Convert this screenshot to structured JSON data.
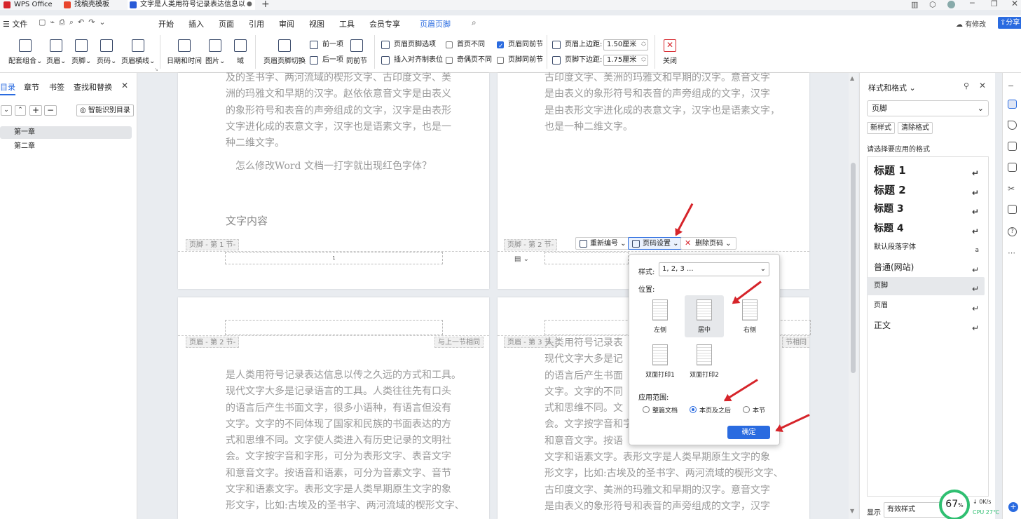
{
  "titlebar": {
    "tabs": [
      {
        "label": "WPS Office",
        "color": "#d6242a"
      },
      {
        "label": "找稿壳模板",
        "color": "#e8452c"
      },
      {
        "label": "文字是人类用符号记录表达信息以",
        "color": "#2a5bd7"
      }
    ],
    "new_tab": "+"
  },
  "menubar": {
    "file": "文件",
    "items": [
      "开始",
      "插入",
      "页面",
      "引用",
      "审阅",
      "视图",
      "工具",
      "会员专享",
      "页眉页脚"
    ],
    "active": "页眉页脚",
    "changes": "有修改",
    "share": "分享"
  },
  "ribbon": {
    "big_buttons": [
      "配套组合",
      "页眉",
      "页脚",
      "页码",
      "页眉横线",
      "日期和时间",
      "图片",
      "域",
      "页眉页脚切换",
      "同前节"
    ],
    "small": {
      "prev": "前一项",
      "next": "后一项",
      "options": "页眉页脚选项",
      "tab_align": "插入对齐制表位",
      "first_page": "首页不同",
      "odd_even": "奇偶页不同",
      "header_same": "页眉同前节",
      "footer_same": "页脚同前节",
      "top_margin_label": "页眉上边距:",
      "top_margin_value": "1.50厘米",
      "bottom_margin_label": "页脚下边距:",
      "bottom_margin_value": "1.75厘米",
      "close": "关闭"
    },
    "checks": {
      "first_page": false,
      "odd_even": false,
      "header_same": true,
      "footer_same": false
    }
  },
  "leftnav": {
    "tabs": [
      "目录",
      "章节",
      "书签",
      "查找和替换"
    ],
    "smart_toc": "智能识别目录",
    "items": [
      "第一章",
      "第二章"
    ]
  },
  "doc": {
    "p1_lines": [
      "及的圣书字、两河流域的楔形文字、古印度文字、美",
      "洲的玛雅文和早期的汉字。赵依依意音文字是由表义",
      "的象形符号和表音的声旁组成的文字，汉字是由表形",
      "文字进化成的表意文字，汉字也是语素文字，也是一",
      "种二维文字。"
    ],
    "p1_question": "怎么修改Word 文档一打字就出现红色字体？",
    "p1_heading": "文字内容",
    "p1_footer_tag": "页脚 - 第 1 节-",
    "p1_page_num": "1",
    "p2_lines": [
      "古印度文字、美洲的玛雅文和早期的汉字。意音文字",
      "是由表义的象形符号和表音的声旁组成的文字，汉字",
      "是由表形文字进化成的表意文字，汉字也是语素文字，",
      "也是一种二维文字。"
    ],
    "p2_footer_tag": "页脚 - 第 2 节-",
    "p3_header_tag": "页眉 - 第 2 节-",
    "p3_same_tag": "与上一节相同",
    "p3_lines": [
      "是人类用符号记录表达信息以传之久远的方式和工具。",
      "现代文字大多是记录语言的工具。人类往往先有口头",
      "的语言后产生书面文字，很多小语种，有语言但没有",
      "文字。文字的不同体现了国家和民族的书面表达的方",
      "式和思维不同。文字使人类进入有历史记录的文明社",
      "会。文字按字音和字形，可分为表形文字、表音文字",
      "和意音文字。按语音和语素，可分为音素文字、音节",
      "文字和语素文字。表形文字是人类早期原生文字的象",
      "形文字，比如:古埃及的圣书字、两河流域的楔形文字、"
    ],
    "p4_header_tag": "页眉 - 第 3 节-",
    "p4_same_tag": "节相同",
    "p4_lines": [
      "人类用符号记录表",
      "现代文字大多是记",
      "的语言后产生书面",
      "文字。文字的不同",
      "式和思维不同。文",
      "会。文字按字音和字",
      "和意音文字。按语",
      "文字和语素文字。表形文字是人类早期原生文字的象",
      "形文字，比如:古埃及的圣书字、两河流域的楔形文字、",
      "古印度文字、美洲的玛雅文和早期的汉字。意音文字",
      "是由表义的象形符号和表音的声旁组成的文字，汉字"
    ]
  },
  "footer_toolbar": {
    "renumber": "重新编号",
    "page_settings": "页码设置",
    "delete": "删除页码"
  },
  "popup": {
    "style_label": "样式:",
    "style_value": "1, 2, 3 ...",
    "position_label": "位置:",
    "positions": [
      "左侧",
      "居中",
      "右侧",
      "双面打印1",
      "双面打印2"
    ],
    "selected_position": "居中",
    "scope_label": "应用范围:",
    "scopes": [
      "整篇文档",
      "本页及之后",
      "本节"
    ],
    "selected_scope": "本页及之后",
    "confirm": "确定"
  },
  "rightpanel": {
    "title": "样式和格式",
    "current": "页脚",
    "new_style": "新样式",
    "clear": "清除格式",
    "prompt": "请选择要应用的格式",
    "styles": [
      "标题 1",
      "标题 2",
      "标题 3",
      "标题 4",
      "默认段落字体",
      "普通(网站)",
      "页脚",
      "页眉",
      "正文"
    ],
    "selected": "页脚",
    "show_label": "显示",
    "show_value": "有效样式"
  },
  "status": {
    "percent": "67",
    "net": "0K/s",
    "cpu": "CPU 27℃"
  },
  "colors": {
    "accent": "#2a6be0",
    "arrow": "#d6242a",
    "wps_red": "#d6242a"
  }
}
